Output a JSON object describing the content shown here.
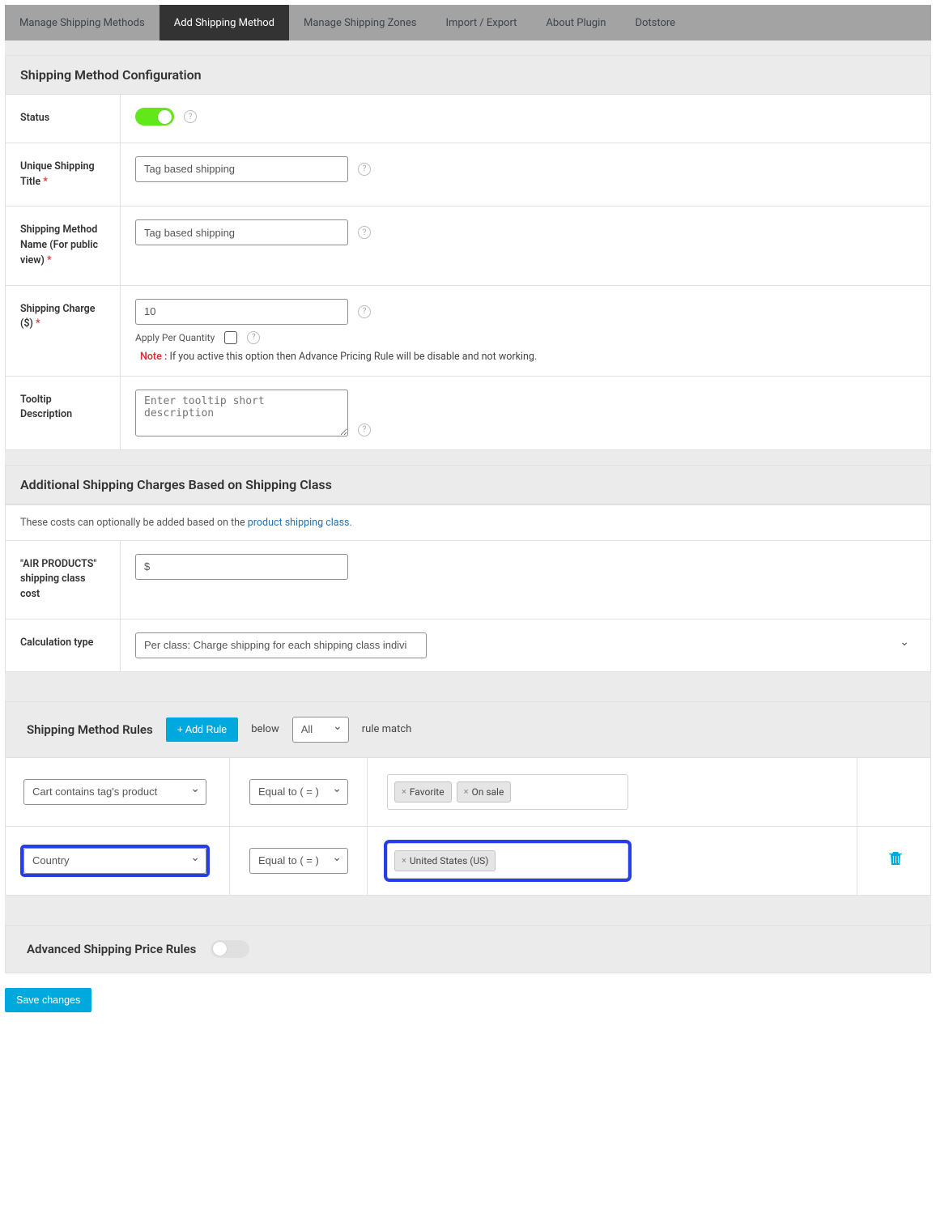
{
  "tabs": {
    "manage_methods": "Manage Shipping Methods",
    "add_method": "Add Shipping Method",
    "manage_zones": "Manage Shipping Zones",
    "import_export": "Import / Export",
    "about": "About Plugin",
    "dotstore": "Dotstore"
  },
  "section1_title": "Shipping Method Configuration",
  "fields": {
    "status_label": "Status",
    "title_label": "Unique Shipping Title",
    "title_value": "Tag based shipping",
    "name_label": "Shipping Method Name (For public view)",
    "name_value": "Tag based shipping",
    "charge_label": "Shipping Charge ($)",
    "charge_value": "10",
    "apply_per_qty": "Apply Per Quantity",
    "note_label": "Note :",
    "note_text": " If you active this option then Advance Pricing Rule will be disable and not working.",
    "tooltip_label": "Tooltip Description",
    "tooltip_placeholder": "Enter tooltip short description"
  },
  "section2_title": "Additional Shipping Charges Based on Shipping Class",
  "section2_info_pre": "These costs can optionally be added based on the ",
  "section2_info_link": "product shipping class",
  "section2_info_post": ".",
  "fields2": {
    "air_label": "\"AIR PRODUCTS\" shipping class cost",
    "air_value": "$",
    "calc_label": "Calculation type",
    "calc_value": "Per class: Charge shipping for each shipping class individually"
  },
  "rules": {
    "title": "Shipping Method Rules",
    "add_btn": "+ Add Rule",
    "below": "below",
    "all": "All",
    "rule_match": "rule match",
    "row1_cond": "Cart contains tag's product",
    "row1_op": "Equal to ( = )",
    "row1_tags": [
      "Favorite",
      "On sale"
    ],
    "row2_cond": "Country",
    "row2_op": "Equal to ( = )",
    "row2_tags": [
      "United States (US)"
    ]
  },
  "adv_title": "Advanced Shipping Price Rules",
  "save": "Save changes"
}
